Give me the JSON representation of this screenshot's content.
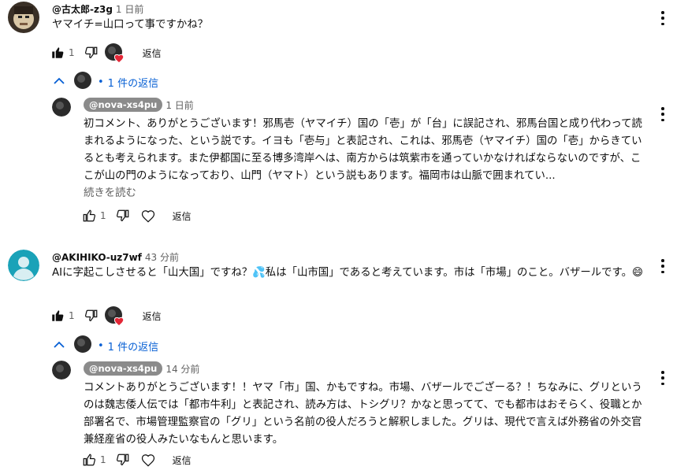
{
  "comments": [
    {
      "author": "@古太郎-z3g",
      "time": "1 日前",
      "text": "ヤマイチ=山口って事ですかね？",
      "likes": "1",
      "reply_label": "返信",
      "replies_toggle": "1 件の返信",
      "avatar_icon": "portrait-avatar-icon"
    },
    {
      "author": "@AKIHIKO-uz7wf",
      "time": "43 分前",
      "text": "AIに字起こしさせると「山大国」ですね？💦私は「山市国」であると考えています。市は「市場」のこと。バザールです。😄",
      "likes": "1",
      "reply_label": "返信",
      "replies_toggle": "1 件の返信",
      "avatar_icon": "default-person-avatar-icon",
      "avatar_color": "#1aa2b8"
    }
  ],
  "replies": [
    {
      "author": "@nova-xs4pu",
      "time": "1 日前",
      "text": "初コメント、ありがとうございます！邪馬壱（ヤマイチ）国の「壱」が「台」に誤記され、邪馬台国と成り代わって読まれるようになった、という説です。イヨも「壱与」と表記され、これは、邪馬壱（ヤマイチ）国の「壱」からきているとも考えられます。また伊都国に至る博多湾岸へは、南方からは筑紫市を通っていかなければならないのですが、ここが山の門のようになっており、山門（ヤマト）という説もあります。福岡市は山脈で囲まれてい...",
      "read_more": "続きを読む",
      "likes": "1",
      "reply_label": "返信"
    },
    {
      "author": "@nova-xs4pu",
      "time": "14 分前",
      "text": "コメントありがとうございます！！ヤマ「市」国、かもですね。市場、バザールでござーる？！ちなみに、グリというのは魏志倭人伝では「都市牛利」と表記され、読み方は、トシグリ？かなと思ってて、でも都市はおそらく、役職とか部署名で、市場管理監察官の「グリ」という名前の役人だろうと解釈しました。グリは、現代で言えば外務省の外交官兼経産省の役人みたいなもんと思います。",
      "likes": "1",
      "reply_label": "返信"
    }
  ]
}
